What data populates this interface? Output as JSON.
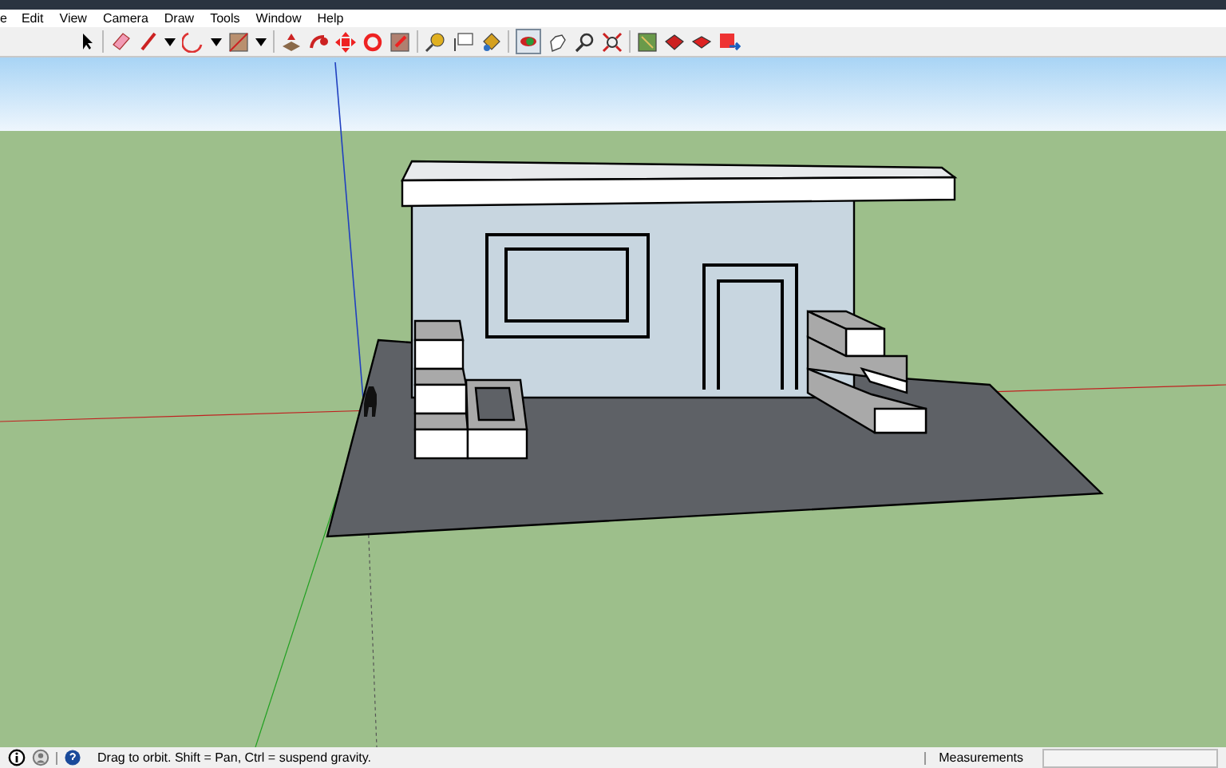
{
  "menu": [
    "e",
    "Edit",
    "View",
    "Camera",
    "Draw",
    "Tools",
    "Window",
    "Help"
  ],
  "status_bar": {
    "hint": "Drag to orbit. Shift = Pan, Ctrl = suspend gravity.",
    "measurements_label": "Measurements"
  }
}
